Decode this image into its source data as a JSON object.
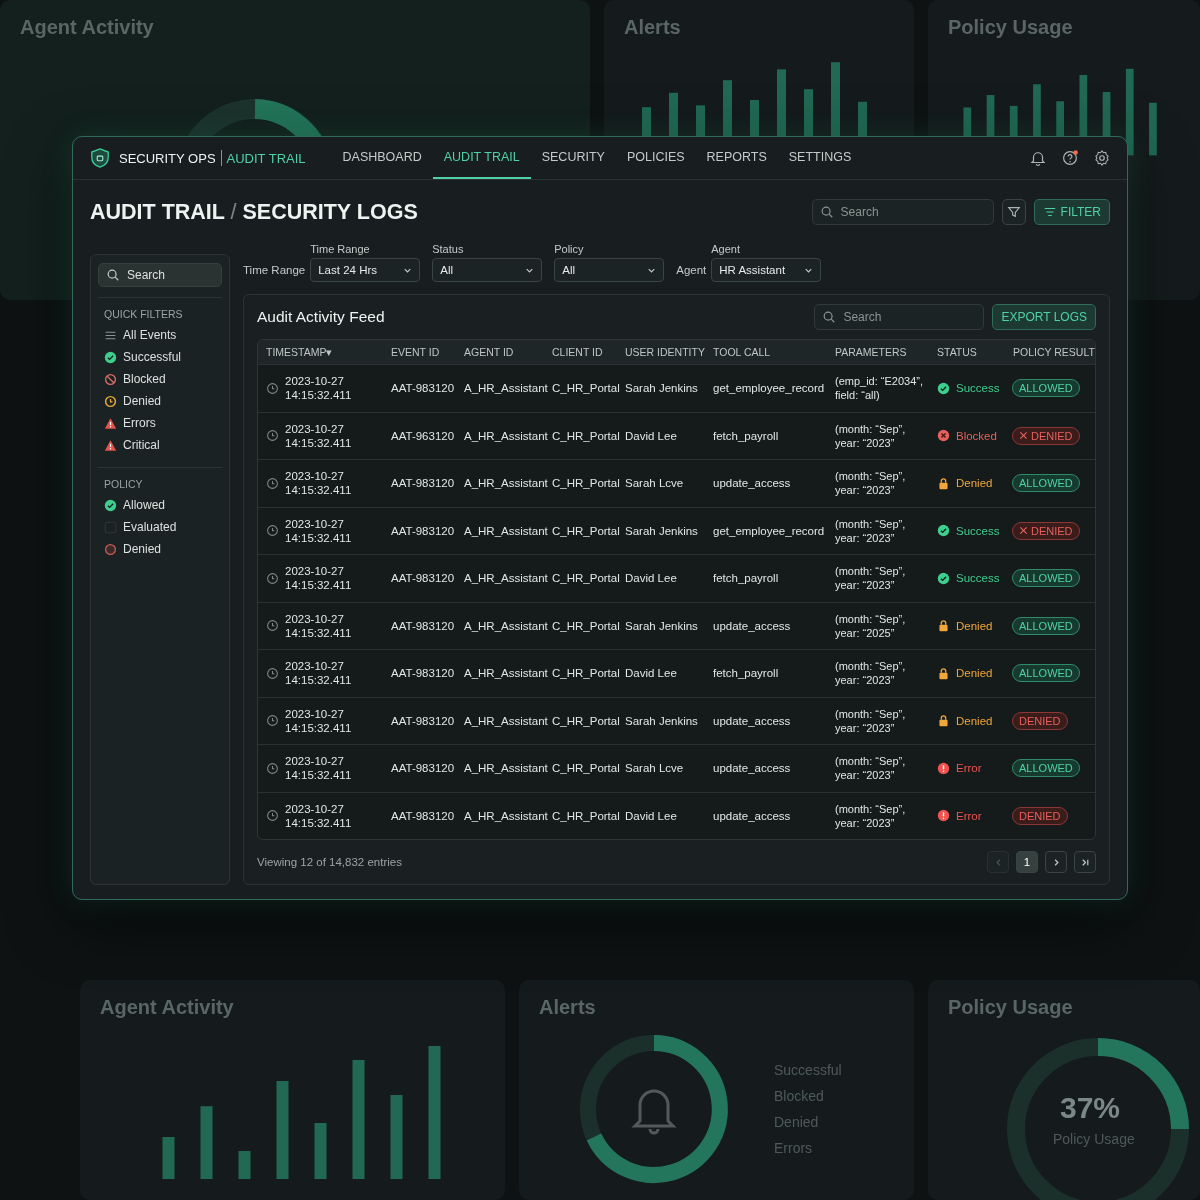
{
  "background": {
    "top_panels": [
      {
        "title": "Agent Activity",
        "kind": "donut"
      },
      {
        "title": "Alerts",
        "kind": "bars"
      },
      {
        "title": "Policy Usage",
        "kind": "bars"
      }
    ],
    "bottom_panels": [
      {
        "title": "Agent Activity",
        "kind": "bars"
      },
      {
        "title": "Alerts",
        "kind": "bell",
        "legend": [
          "Successful",
          "Blocked",
          "Denied",
          "Errors"
        ]
      },
      {
        "title": "Policy Usage",
        "kind": "gauge",
        "value": "37%",
        "caption": "Policy Usage"
      }
    ]
  },
  "window": {
    "brand": "SECURITY OPS",
    "section": "AUDIT TRAIL",
    "nav": [
      {
        "label": "DASHBOARD",
        "selected": false
      },
      {
        "label": "AUDIT TRAIL",
        "selected": true
      },
      {
        "label": "SECURITY",
        "selected": false
      },
      {
        "label": "POLICIES",
        "selected": false
      },
      {
        "label": "REPORTS",
        "selected": false
      },
      {
        "label": "SETTINGS",
        "selected": false
      }
    ],
    "help_badge": true,
    "page_title": "AUDIT TRAIL",
    "title_separator": "/",
    "page_subtitle": "SECURITY LOGS",
    "search": {
      "placeholder": "Search"
    },
    "filter_button": "FILTER"
  },
  "sidebar": {
    "search": {
      "placeholder": "Search"
    },
    "sections": [
      {
        "heading": "QUICK FILTERS",
        "items": [
          {
            "label": "All Events",
            "kind": "list"
          },
          {
            "label": "Successful",
            "kind": "success"
          },
          {
            "label": "Blocked",
            "kind": "blocked"
          },
          {
            "label": "Denied",
            "kind": "pending"
          },
          {
            "label": "Errors",
            "kind": "warning"
          },
          {
            "label": "Critical",
            "kind": "warning"
          }
        ]
      },
      {
        "heading": "POLICY",
        "items": [
          {
            "label": "Allowed",
            "kind": "success"
          },
          {
            "label": "Evaluated",
            "kind": "empty"
          },
          {
            "label": "Denied",
            "kind": "ring"
          }
        ]
      }
    ]
  },
  "filters": [
    {
      "label": "Time Range",
      "side_label": "Time Range",
      "value": "Last 24 Hrs"
    },
    {
      "label": "Status",
      "value": "All"
    },
    {
      "label": "Policy",
      "value": "All"
    },
    {
      "label": "Agent",
      "side_label": "Agent",
      "value": "HR Assistant"
    }
  ],
  "feed": {
    "title": "Audit Activity Feed",
    "search": {
      "placeholder": "Search"
    },
    "export_button": "EXPORT LOGS",
    "columns": [
      "TIMESTAMP",
      "EVENT ID",
      "AGENT ID",
      "CLIENT ID",
      "USER IDENTITY",
      "TOOL CALL",
      "PARAMETERS",
      "STATUS",
      "POLICY RESULT"
    ],
    "sort_mark": "▾",
    "rows": [
      {
        "date": "2023-10-27",
        "time": "14:15:32.411",
        "event_id": "AAT-983120",
        "agent_id": "A_HR_Assistant",
        "client_id": "C_HR_Portal",
        "user": "Sarah Jenkins",
        "tool": "get_employee_record",
        "params": [
          "(emp_id: “E2034”,",
          "field: “all)"
        ],
        "status": {
          "label": "Success",
          "kind": "success"
        },
        "policy": {
          "label": "ALLOWED",
          "kind": "allowed",
          "cross": false
        }
      },
      {
        "date": "2023-10-27",
        "time": "14:15:32.411",
        "event_id": "AAT-963120",
        "agent_id": "A_HR_Assistant",
        "client_id": "C_HR_Portal",
        "user": "David Lee",
        "tool": "fetch_payroll",
        "params": [
          "(month: “Sep”,",
          "year: “2023”"
        ],
        "status": {
          "label": "Blocked",
          "kind": "blocked"
        },
        "policy": {
          "label": "DENIED",
          "kind": "denied",
          "cross": true
        }
      },
      {
        "date": "2023-10-27",
        "time": "14:15:32.411",
        "event_id": "AAT-983120",
        "agent_id": "A_HR_Assistant",
        "client_id": "C_HR_Portal",
        "user": "Sarah Lcve",
        "tool": "update_access",
        "params": [
          "(month: “Sep”,",
          "year: “2023”"
        ],
        "status": {
          "label": "Denied",
          "kind": "denied"
        },
        "policy": {
          "label": "ALLOWED",
          "kind": "allowed",
          "cross": false
        }
      },
      {
        "date": "2023-10-27",
        "time": "14:15:32.411",
        "event_id": "AAT-983120",
        "agent_id": "A_HR_Assistant",
        "client_id": "C_HR_Portal",
        "user": "Sarah Jenkins",
        "tool": "get_employee_record",
        "params": [
          "(month: “Sep”,",
          "year: “2023”"
        ],
        "status": {
          "label": "Success",
          "kind": "success"
        },
        "policy": {
          "label": "DENIED",
          "kind": "denied",
          "cross": true
        }
      },
      {
        "date": "2023-10-27",
        "time": "14:15:32.411",
        "event_id": "AAT-983120",
        "agent_id": "A_HR_Assistant",
        "client_id": "C_HR_Portal",
        "user": "David Lee",
        "tool": "fetch_payroll",
        "params": [
          "(month: “Sep”,",
          "year: “2023”"
        ],
        "status": {
          "label": "Success",
          "kind": "success"
        },
        "policy": {
          "label": "ALLOWED",
          "kind": "allowed",
          "cross": false
        }
      },
      {
        "date": "2023-10-27",
        "time": "14:15:32.411",
        "event_id": "AAT-983120",
        "agent_id": "A_HR_Assistant",
        "client_id": "C_HR_Portal",
        "user": "Sarah Jenkins",
        "tool": "update_access",
        "params": [
          "(month: “Sep”,",
          "year: “2025”"
        ],
        "status": {
          "label": "Denied",
          "kind": "denied"
        },
        "policy": {
          "label": "ALLOWED",
          "kind": "allowed",
          "cross": false
        }
      },
      {
        "date": "2023-10-27",
        "time": "14:15:32.411",
        "event_id": "AAT-983120",
        "agent_id": "A_HR_Assistant",
        "client_id": "C_HR_Portal",
        "user": "David Lee",
        "tool": "fetch_payroll",
        "params": [
          "(month: “Sep”,",
          "year: “2023”"
        ],
        "status": {
          "label": "Denied",
          "kind": "denied"
        },
        "policy": {
          "label": "ALLOWED",
          "kind": "allowed",
          "cross": false
        }
      },
      {
        "date": "2023-10-27",
        "time": "14:15:32.411",
        "event_id": "AAT-983120",
        "agent_id": "A_HR_Assistant",
        "client_id": "C_HR_Portal",
        "user": "Sarah Jenkins",
        "tool": "update_access",
        "params": [
          "(month: “Sep”,",
          "year: “2023”"
        ],
        "status": {
          "label": "Denied",
          "kind": "denied"
        },
        "policy": {
          "label": "DENIED",
          "kind": "denied",
          "cross": false
        }
      },
      {
        "date": "2023-10-27",
        "time": "14:15:32.411",
        "event_id": "AAT-983120",
        "agent_id": "A_HR_Assistant",
        "client_id": "C_HR_Portal",
        "user": "Sarah Lcve",
        "tool": "update_access",
        "params": [
          "(month: “Sep”,",
          "year: “2023”"
        ],
        "status": {
          "label": "Error",
          "kind": "error"
        },
        "policy": {
          "label": "ALLOWED",
          "kind": "allowed",
          "cross": false
        }
      },
      {
        "date": "2023-10-27",
        "time": "14:15:32.411",
        "event_id": "AAT-983120",
        "agent_id": "A_HR_Assistant",
        "client_id": "C_HR_Portal",
        "user": "David Lee",
        "tool": "update_access",
        "params": [
          "(month: “Sep”,",
          "year: “2023”"
        ],
        "status": {
          "label": "Error",
          "kind": "error"
        },
        "policy": {
          "label": "DENIED",
          "kind": "denied",
          "cross": false
        }
      }
    ],
    "footer": "Viewing 12 of 14,832 entries",
    "pagination": [
      {
        "kind": "prev",
        "disabled": true,
        "selected": false
      },
      {
        "kind": "page",
        "label": "1",
        "disabled": false,
        "selected": true
      },
      {
        "kind": "next",
        "disabled": false,
        "selected": false
      },
      {
        "kind": "last",
        "disabled": false,
        "selected": false
      }
    ]
  }
}
